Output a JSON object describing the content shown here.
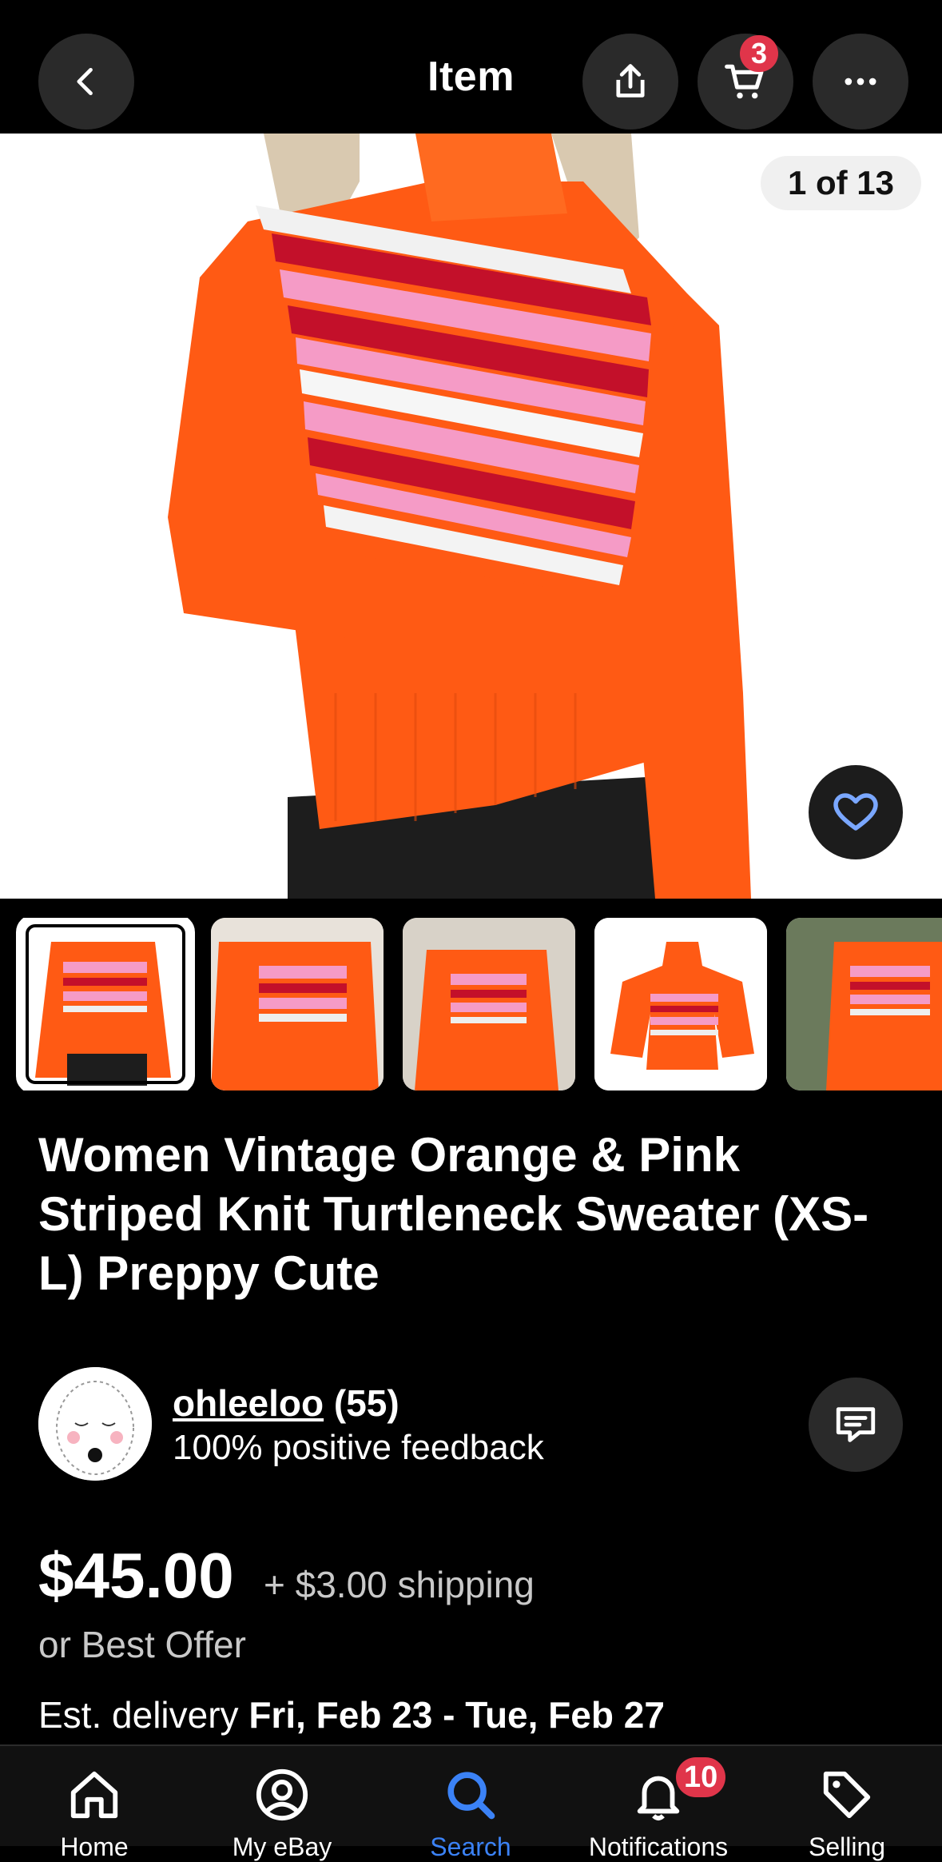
{
  "header": {
    "title": "Item",
    "cart_count": "3"
  },
  "gallery": {
    "counter": "1 of 13",
    "thumbnails": [
      "thumb-1",
      "thumb-2",
      "thumb-3",
      "thumb-4",
      "thumb-5"
    ]
  },
  "listing": {
    "title": "Women Vintage Orange & Pink Striped Knit Turtleneck Sweater (XS-L) Preppy Cute",
    "seller_name": "ohleeloo",
    "seller_score": "(55)",
    "feedback": "100% positive feedback",
    "price": "$45.00",
    "shipping": "+ $3.00 shipping",
    "offer": "or Best Offer",
    "delivery_label": "Est. delivery",
    "delivery_dates": "Fri, Feb 23 - Tue, Feb 27"
  },
  "nav": {
    "items": [
      {
        "label": "Home",
        "icon": "home-icon"
      },
      {
        "label": "My eBay",
        "icon": "user-icon"
      },
      {
        "label": "Search",
        "icon": "search-icon"
      },
      {
        "label": "Notifications",
        "icon": "bell-icon"
      },
      {
        "label": "Selling",
        "icon": "tag-icon"
      }
    ],
    "notifications_count": "10",
    "active": "Search"
  },
  "colors": {
    "accent": "#3b82f6",
    "badge": "#e0354a",
    "sweater_orange": "#ff5a14"
  }
}
